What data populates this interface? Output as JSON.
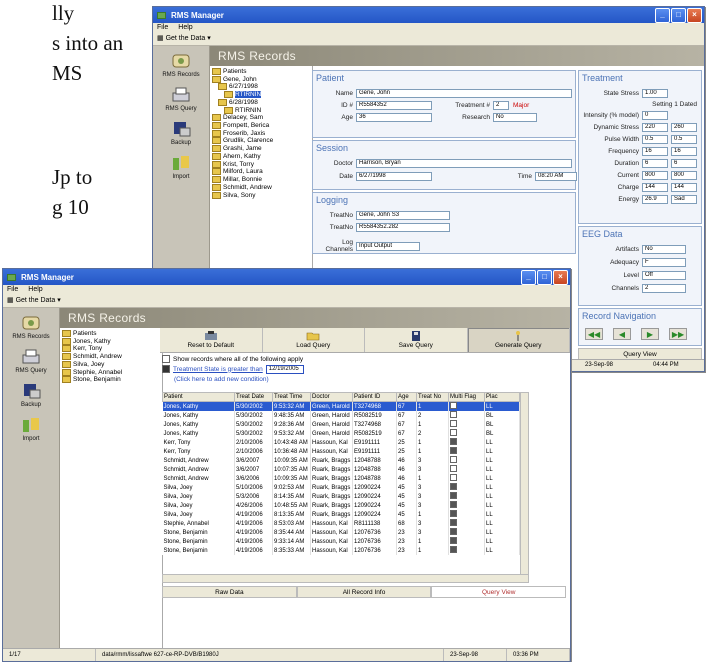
{
  "background_text": {
    "line1": "lly",
    "line2": "s into an",
    "line3": "MS",
    "line4": "Jp to",
    "line5": "g 10"
  },
  "app": {
    "title": "RMS Manager",
    "menu": [
      "File",
      "Help"
    ],
    "toolbar_label": "Get the Data",
    "header": "RMS Records",
    "nav": [
      "RMS Records",
      "RMS Query",
      "Backup",
      "Import"
    ]
  },
  "back": {
    "tree": [
      {
        "label": "Patients",
        "indent": 0
      },
      {
        "label": "Gene, John",
        "indent": 0
      },
      {
        "label": "6/27/1998",
        "indent": 1
      },
      {
        "label": "RTIRNIN",
        "indent": 2,
        "selected": true
      },
      {
        "label": "6/28/1998",
        "indent": 1
      },
      {
        "label": "RTIRNIN",
        "indent": 2
      },
      {
        "label": "Delacey, Sam",
        "indent": 0
      },
      {
        "label": "Fornpett, Berica",
        "indent": 0
      },
      {
        "label": "Froserib, Jaxis",
        "indent": 0
      },
      {
        "label": "Grudlik, Clarence",
        "indent": 0
      },
      {
        "label": "Grashi, Jame",
        "indent": 0
      },
      {
        "label": "Ahern, Kathy",
        "indent": 0
      },
      {
        "label": "Krist, Torry",
        "indent": 0
      },
      {
        "label": "Milford, Laura",
        "indent": 0
      },
      {
        "label": "Millar, Bonnie",
        "indent": 0
      },
      {
        "label": "Schmidt, Andrew",
        "indent": 0
      },
      {
        "label": "Silva, Sony",
        "indent": 0
      }
    ],
    "patient": {
      "title": "Patient",
      "name_label": "Name",
      "name": "Gene, John",
      "id_label": "ID #",
      "id": "R5584352",
      "treatment_label": "Treatment #",
      "treatment": "2",
      "major": "Major",
      "age_label": "Age",
      "age": "36",
      "research_label": "Research",
      "research": "No"
    },
    "session": {
      "title": "Session",
      "doctor_label": "Doctor",
      "doctor": "Harrison, Bryan",
      "date_label": "Date",
      "date": "6/27/1998",
      "time_label": "Time",
      "time": "08:20 AM"
    },
    "logging": {
      "title": "Logging",
      "t1_label": "TreatNo",
      "t1": "Gene, John S3",
      "t2_label": "TreatNo",
      "t2": "R5584352.282",
      "channels_label": "Log Channels",
      "channels": "Input  Output"
    },
    "treatment": {
      "title": "Treatment",
      "state_label": "State Stress",
      "state": "1.00",
      "setting_label": "Setting",
      "setting": "1  Dated",
      "intensity_label": "Intensity (% model)",
      "intensity": "0",
      "dynamic_label": "Dynamic Stress",
      "dynamic": [
        "220",
        "260"
      ],
      "pulse_label": "Pulse Width",
      "pulse": [
        "0.5",
        "0.5"
      ],
      "freq_label": "Frequency",
      "freq": [
        "16",
        "16"
      ],
      "duration_label": "Duration",
      "duration": [
        "6",
        "6"
      ],
      "current_label": "Current",
      "current": [
        "800",
        "800"
      ],
      "charge_label": "Charge",
      "charge": [
        "144",
        "144"
      ],
      "energy_label": "Energy",
      "energy": [
        "26.9",
        "Sad"
      ]
    },
    "eeg": {
      "title": "EEG Data",
      "artifacts_label": "Artifacts",
      "artifacts": "No",
      "adequacy_label": "Adequacy",
      "adequacy": "F",
      "level_label": "Level",
      "level": "Off",
      "channels_label": "Channels",
      "channels": "2"
    },
    "record_nav": {
      "title": "Record Navigation",
      "buttons": [
        "◀◀",
        "◀",
        "▶",
        "▶▶"
      ]
    },
    "query_view_tab": "Query View",
    "status": [
      "23-Sep-98",
      "04:44 PM"
    ]
  },
  "front": {
    "tree": [
      {
        "label": "Patients",
        "indent": 0
      },
      {
        "label": "Jones, Kathy",
        "indent": 0
      },
      {
        "label": "Kerr, Tony",
        "indent": 0
      },
      {
        "label": "Schmidt, Andrew",
        "indent": 0
      },
      {
        "label": "Silva, Joey",
        "indent": 0
      },
      {
        "label": "Stephie, Annabel",
        "indent": 0
      },
      {
        "label": "Stone, Benjamin",
        "indent": 0
      }
    ],
    "query_buttons": [
      "Reset to Default",
      "Load Query",
      "Save Query",
      "Generate Query"
    ],
    "query": {
      "match_text": "Show records where all of the following apply",
      "condition": "Treatment State  is greater than",
      "condition_value": "12/19/2005",
      "add_text": "(Click here to add new condition)"
    },
    "columns": [
      "Patient",
      "Treat Date",
      "Treat Time",
      "Doctor",
      "Patient ID",
      "Age",
      "Treat No",
      "Multi Flag",
      "Plac"
    ],
    "rows": [
      [
        "Jones, Kathy",
        "5/30/2002",
        "9:53:32 AM",
        "Green, Harold",
        "T3274968",
        "67",
        "1",
        "",
        "LL"
      ],
      [
        "Jones, Kathy",
        "5/30/2002",
        "9:48:35 AM",
        "Green, Harold",
        "R5082519",
        "67",
        "2",
        "",
        "BL"
      ],
      [
        "Jones, Kathy",
        "5/30/2002",
        "9:28:36 AM",
        "Green, Harold",
        "T3274968",
        "67",
        "1",
        "",
        "BL"
      ],
      [
        "Jones, Kathy",
        "5/30/2002",
        "9:53:32 AM",
        "Green, Harold",
        "R5082519",
        "67",
        "2",
        "",
        "BL"
      ],
      [
        "Kerr, Tony",
        "2/10/2006",
        "10:43:48 AM",
        "Hassoun, Kal",
        "E9191111",
        "25",
        "1",
        "x",
        "LL"
      ],
      [
        "Kerr, Tony",
        "2/10/2006",
        "10:36:48 AM",
        "Hassoun, Kal",
        "E9191111",
        "25",
        "1",
        "x",
        "LL"
      ],
      [
        "Schmidt, Andrew",
        "3/6/2007",
        "10:09:35 AM",
        "Ruark, Braggs",
        "12048788",
        "46",
        "3",
        "",
        "LL"
      ],
      [
        "Schmidt, Andrew",
        "3/6/2007",
        "10:07:35 AM",
        "Ruark, Braggs",
        "12048788",
        "46",
        "3",
        "",
        "LL"
      ],
      [
        "Schmidt, Andrew",
        "3/6/2006",
        "10:09:35 AM",
        "Ruark, Braggs",
        "12048788",
        "46",
        "1",
        "",
        "LL"
      ],
      [
        "Silva, Joey",
        "5/10/2006",
        "9:02:53 AM",
        "Ruark, Braggs",
        "12090224",
        "45",
        "3",
        "x",
        "LL"
      ],
      [
        "Silva, Joey",
        "5/3/2006",
        "8:14:35 AM",
        "Ruark, Braggs",
        "12090224",
        "45",
        "3",
        "x",
        "LL"
      ],
      [
        "Silva, Joey",
        "4/26/2006",
        "10:48:55 AM",
        "Ruark, Braggs",
        "12090224",
        "45",
        "3",
        "x",
        "LL"
      ],
      [
        "Silva, Joey",
        "4/19/2006",
        "8:13:35 AM",
        "Ruark, Braggs",
        "12090224",
        "45",
        "1",
        "x",
        "LL"
      ],
      [
        "Stephie, Annabel",
        "4/19/2006",
        "8:53:03 AM",
        "Hassoun, Kal",
        "R8111138",
        "68",
        "3",
        "x",
        "LL"
      ],
      [
        "Stone, Benjamin",
        "4/19/2006",
        "8:35:44 AM",
        "Hassoun, Kal",
        "12076736",
        "23",
        "3",
        "x",
        "LL"
      ],
      [
        "Stone, Benjamin",
        "4/19/2006",
        "9:33:14 AM",
        "Hassoun, Kal",
        "12076736",
        "23",
        "1",
        "x",
        "LL"
      ],
      [
        "Stone, Benjamin",
        "4/19/2006",
        "8:35:33 AM",
        "Hassoun, Kal",
        "12076736",
        "23",
        "1",
        "x",
        "LL"
      ]
    ],
    "bottom_tabs": [
      "Raw Data",
      "All Record Info",
      "Query View"
    ],
    "status": [
      "1/17",
      "data/rmm/lissaftwe 627-ce-RP-DVB/B1980J",
      "23-Sep-98",
      "03:36 PM"
    ]
  },
  "colors": {
    "title_bar": "#2456c6",
    "header": "#8c8878",
    "group_title": "#4d74b6",
    "selection": "#2a5bd0"
  }
}
